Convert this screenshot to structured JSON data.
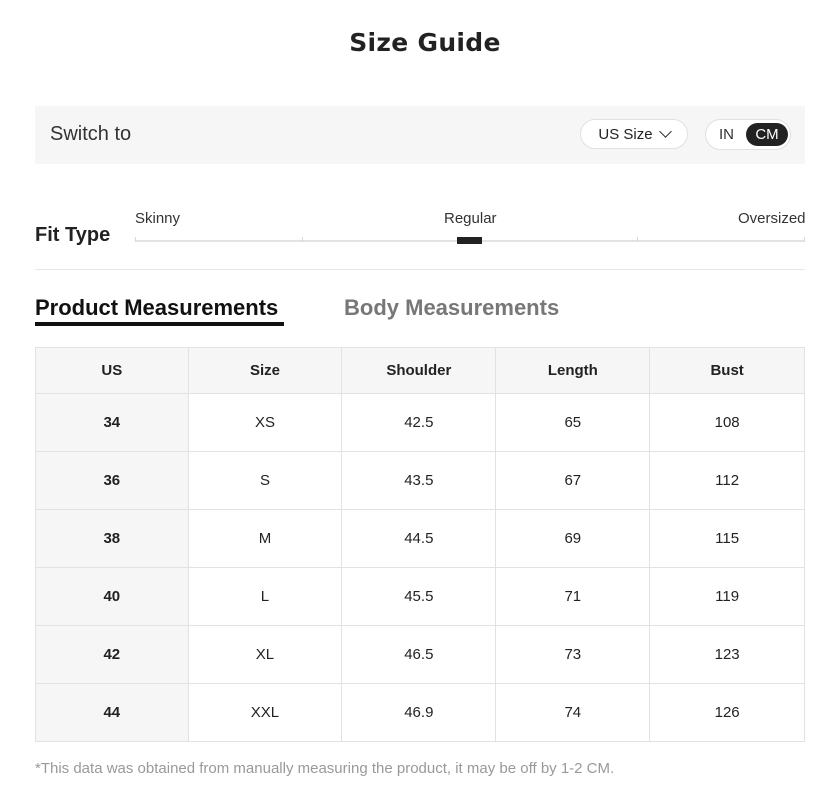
{
  "title": "Size Guide",
  "switch": {
    "label": "Switch to",
    "size_system": "US Size",
    "units": {
      "in": "IN",
      "cm": "CM",
      "selected": "CM"
    }
  },
  "fit": {
    "label": "Fit Type",
    "options": [
      "Skinny",
      "Regular",
      "Oversized"
    ],
    "selected": "Regular"
  },
  "tabs": {
    "product": "Product Measurements",
    "body": "Body Measurements",
    "active": "product"
  },
  "table": {
    "headers": [
      "US",
      "Size",
      "Shoulder",
      "Length",
      "Bust"
    ],
    "rows": [
      [
        "34",
        "XS",
        "42.5",
        "65",
        "108"
      ],
      [
        "36",
        "S",
        "43.5",
        "67",
        "112"
      ],
      [
        "38",
        "M",
        "44.5",
        "69",
        "115"
      ],
      [
        "40",
        "L",
        "45.5",
        "71",
        "119"
      ],
      [
        "42",
        "XL",
        "46.5",
        "73",
        "123"
      ],
      [
        "44",
        "XXL",
        "46.9",
        "74",
        "126"
      ]
    ]
  },
  "note": "*This data was obtained from manually measuring the product, it may be off by 1-2 CM."
}
